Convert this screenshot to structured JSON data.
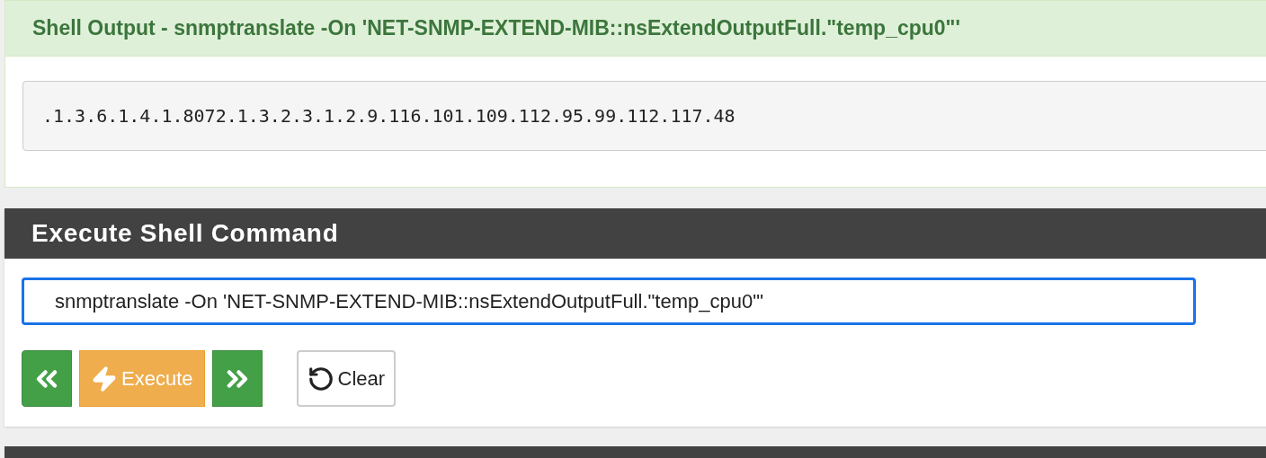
{
  "output_panel": {
    "title": "Shell Output - snmptranslate -On 'NET-SNMP-EXTEND-MIB::nsExtendOutputFull.\"temp_cpu0\"'",
    "output": ".1.3.6.1.4.1.8072.1.3.2.3.1.2.9.116.101.109.112.95.99.112.117.48"
  },
  "command_panel": {
    "title": "Execute Shell Command",
    "command": "snmptranslate -On 'NET-SNMP-EXTEND-MIB::nsExtendOutputFull.\"temp_cpu0\"'",
    "focused": true,
    "buttons": [
      {
        "kind": "previous"
      },
      {
        "kind": "execute",
        "label": "Execute"
      },
      {
        "kind": "next"
      },
      {
        "kind": "clear",
        "label": "Clear"
      }
    ]
  }
}
